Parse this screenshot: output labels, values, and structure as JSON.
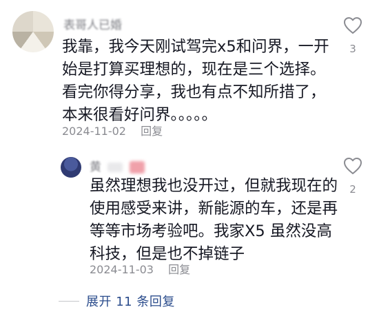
{
  "comments": [
    {
      "username": "表哥人已婚",
      "text_lines": [
        "我靠，我今天刚试驾完x5和问界，一开",
        "始是打算买理想的，现在是三个选择。",
        "看完你得分享，我也有点不知所措了，",
        "本来很看好问界。。。。。"
      ],
      "date": "2024-11-02",
      "reply_label": "回复",
      "like_count": "3"
    },
    {
      "username": "黄",
      "text_lines": [
        "虽然理想我也没开过，但就我现在的",
        "使用感受来讲，新能源的车，还是再",
        "等等市场考验吧。我家X5 虽然没高",
        "科技，但是也不掉链子"
      ],
      "date": "2024-11-03",
      "reply_label": "回复",
      "like_count": "2"
    }
  ],
  "expand_replies_label": "展开 11 条回复",
  "colors": {
    "text": "#161823",
    "meta": "#8a8b91",
    "link": "#2b4c8c"
  },
  "icons": [
    "heart-outline-icon"
  ]
}
